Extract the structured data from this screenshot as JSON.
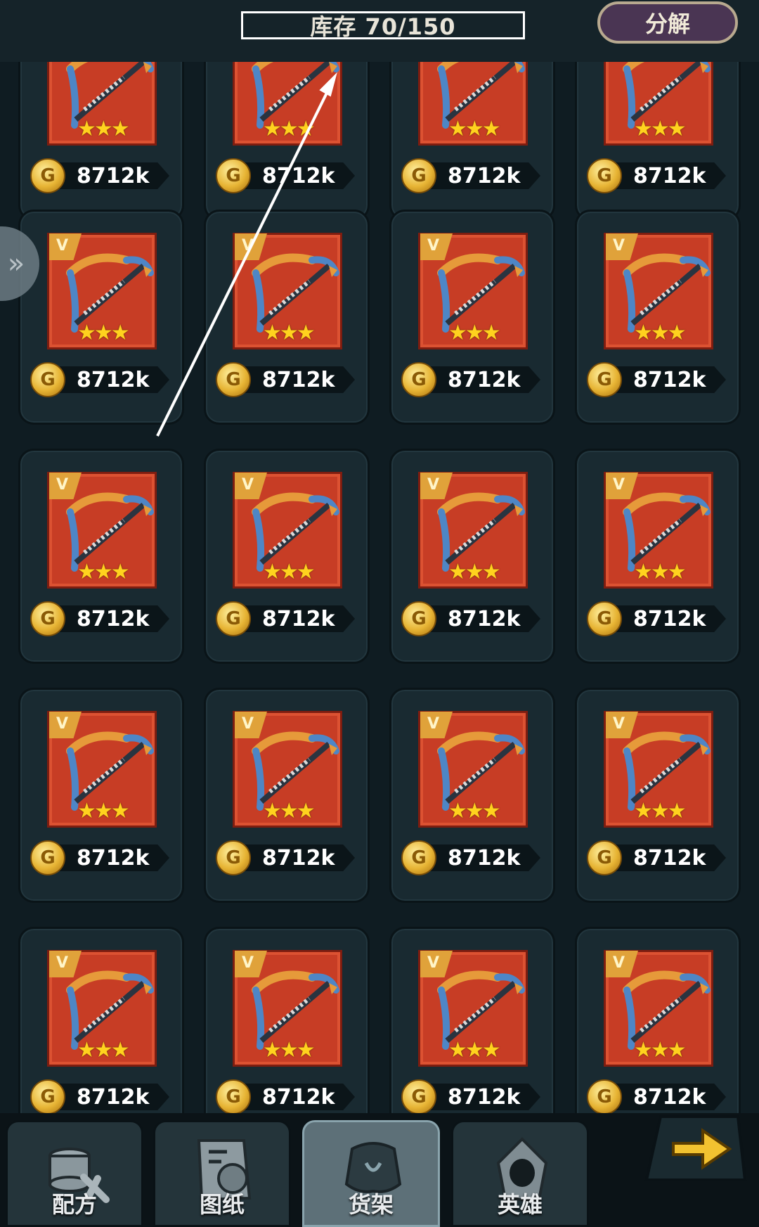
{
  "header": {
    "inventory_label": "库存 70/150",
    "decompose_label": "分解"
  },
  "item": {
    "badge": "V",
    "stars": "★★★",
    "coin_symbol": "G",
    "price": "8712k"
  },
  "grid": {
    "columns": 4,
    "rows": 5,
    "cell_count": 20
  },
  "tabs": [
    {
      "label": "配方",
      "icon": "recipe-icon",
      "active": false
    },
    {
      "label": "图纸",
      "icon": "blueprint-icon",
      "active": false
    },
    {
      "label": "货架",
      "icon": "shelf-icon",
      "active": true
    },
    {
      "label": "英雄",
      "icon": "hero-icon",
      "active": false
    }
  ],
  "colors": {
    "background": "#0f1c22",
    "item_bg": "#c73d25",
    "star": "#ffd21e",
    "coin": "#e7b434",
    "decompose_button": "#4a3553"
  },
  "icons": {
    "side_tab": "chevron-right-icon",
    "next_button": "arrow-right-icon"
  }
}
